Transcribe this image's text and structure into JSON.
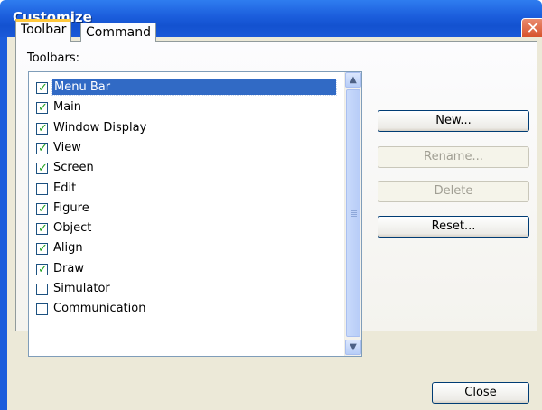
{
  "window": {
    "title": "Customize",
    "close_glyph": "✕"
  },
  "tabs": [
    {
      "label": "Toolbar",
      "active": true
    },
    {
      "label": "Command",
      "active": false
    }
  ],
  "toolbars_label": "Toolbars:",
  "toolbars": [
    {
      "label": "Menu Bar",
      "checked": true,
      "selected": true
    },
    {
      "label": "Main",
      "checked": true
    },
    {
      "label": "Window Display",
      "checked": true
    },
    {
      "label": "View",
      "checked": true
    },
    {
      "label": "Screen",
      "checked": true
    },
    {
      "label": "Edit",
      "checked": false
    },
    {
      "label": "Figure",
      "checked": true
    },
    {
      "label": "Object",
      "checked": true
    },
    {
      "label": "Align",
      "checked": true
    },
    {
      "label": "Draw",
      "checked": true
    },
    {
      "label": "Simulator",
      "checked": false
    },
    {
      "label": "Communication",
      "checked": false
    }
  ],
  "check_glyph": "✓",
  "scrollbar": {
    "up_icon": "▲",
    "down_icon": "▼"
  },
  "buttons": {
    "new": "New...",
    "rename": "Rename...",
    "delete": "Delete",
    "reset": "Reset..."
  },
  "close_button": "Close",
  "colors": {
    "title_bar": "#1b5ddc",
    "selection": "#316ac5",
    "check": "#21a121",
    "close_button": "#d44a22"
  }
}
